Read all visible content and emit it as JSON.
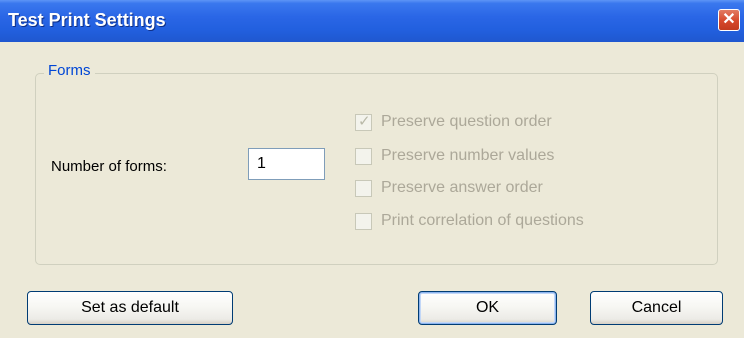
{
  "window": {
    "title": "Test Print Settings",
    "close_icon": "✕"
  },
  "forms_group": {
    "label": "Forms",
    "number_of_forms_label": "Number of forms:",
    "number_of_forms_value": "1",
    "options": [
      {
        "label": "Preserve question order",
        "checked": true,
        "enabled": false
      },
      {
        "label": "Preserve number values",
        "checked": false,
        "enabled": false
      },
      {
        "label": "Preserve answer order",
        "checked": false,
        "enabled": false
      },
      {
        "label": "Print correlation of questions",
        "checked": false,
        "enabled": false
      }
    ],
    "check_mark": "✓"
  },
  "buttons": {
    "set_default": "Set as default",
    "ok": "OK",
    "cancel": "Cancel"
  },
  "colors": {
    "titlebar": "#2a66e6",
    "group_label": "#0046d5",
    "disabled_text": "#aca899",
    "dialog_bg": "#ece9d8"
  }
}
